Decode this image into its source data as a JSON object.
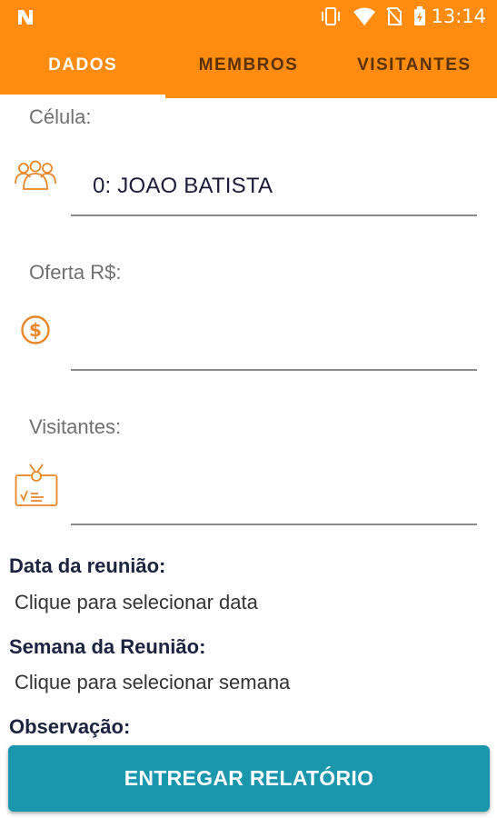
{
  "status_bar": {
    "time": "13:14",
    "icons": [
      "n-logo-icon",
      "vibrate-icon",
      "wifi-icon",
      "no-sim-icon",
      "battery-charging-icon"
    ]
  },
  "tabs": [
    {
      "label": "DADOS",
      "active": true
    },
    {
      "label": "MEMBROS",
      "active": false
    },
    {
      "label": "VISITANTES",
      "active": false
    }
  ],
  "form": {
    "celula": {
      "label": "Célula:",
      "value": "0: JOAO BATISTA",
      "icon": "group-icon"
    },
    "oferta": {
      "label": "Oferta R$:",
      "value": "",
      "icon": "dollar-icon"
    },
    "visitantes": {
      "label": "Visitantes:",
      "value": "",
      "icon": "badge-icon"
    }
  },
  "meeting": {
    "date_title": "Data da reunião:",
    "date_link": "Clique para selecionar data",
    "week_title": "Semana da Reunião:",
    "week_link": "Clique para selecionar semana",
    "notes_title": "Observação:"
  },
  "submit_label": "ENTREGAR RELATÓRIO",
  "colors": {
    "primary": "#ff8c0f",
    "button": "#1a96ad",
    "icon": "#e8872a"
  }
}
